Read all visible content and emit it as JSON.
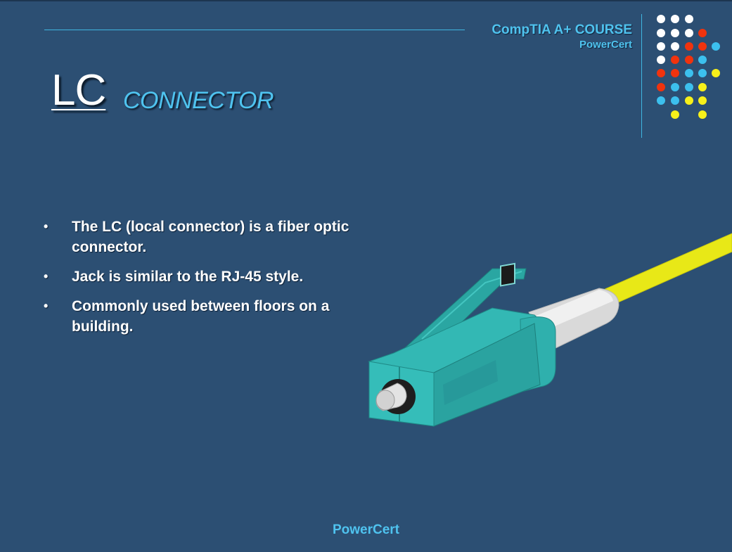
{
  "header": {
    "course_title": "CompTIA A+ COURSE",
    "brand": "PowerCert"
  },
  "title": {
    "main": "LC",
    "sub": "CONNECTOR"
  },
  "bullets": [
    "The LC (local connector) is a fiber optic connector.",
    "Jack is similar to the RJ-45 style.",
    "Commonly used between floors on a building."
  ],
  "footer": {
    "brand": "PowerCert"
  },
  "colors": {
    "background": "#2c4f73",
    "accent": "#4fc3ef",
    "dot_white": "#ffffff",
    "dot_red": "#f0330e",
    "dot_blue": "#3cc0ee",
    "dot_yellow": "#f7f01a",
    "connector_body": "#2fb0ad",
    "cable": "#e8e817"
  },
  "dot_rows": [
    [
      "white",
      "white",
      "white"
    ],
    [
      "white",
      "white",
      "white",
      "red"
    ],
    [
      "white",
      "white",
      "red",
      "red",
      "blue"
    ],
    [
      "white",
      "red",
      "red",
      "blue"
    ],
    [
      "red",
      "red",
      "blue",
      "blue",
      "yellow"
    ],
    [
      "red",
      "blue",
      "blue",
      "yellow"
    ],
    [
      "blue",
      "blue",
      "yellow",
      "yellow"
    ],
    [
      "yellow",
      "yellow"
    ]
  ]
}
